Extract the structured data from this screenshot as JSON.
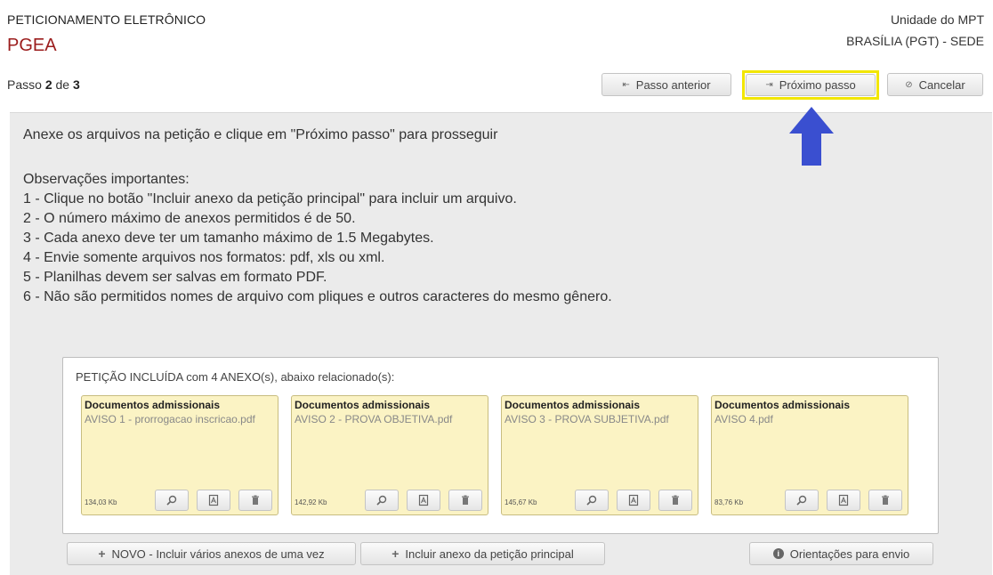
{
  "header": {
    "app_label": "PETICIONAMENTO ELETRÔNICO",
    "app_title": "PGEA",
    "unit_label": "Unidade do MPT",
    "unit_value": "BRASÍLIA (PGT) - SEDE"
  },
  "step": {
    "prefix": "Passo",
    "current": "2",
    "sep": "de",
    "total": "3"
  },
  "toolbar": {
    "prev_label": "Passo anterior",
    "next_label": "Próximo passo",
    "cancel_label": "Cancelar"
  },
  "instructions": "Anexe os arquivos na petição e clique em \"Próximo passo\" para prosseguir",
  "notes": {
    "title": "Observações importantes:",
    "items": [
      "1 - Clique no botão \"Incluir anexo da petição principal\" para incluir um arquivo.",
      "2 - O número máximo de anexos permitidos é de 50.",
      "3 - Cada anexo deve ter um tamanho máximo de 1.5 Megabytes.",
      "4 - Envie somente arquivos nos formatos: pdf, xls ou xml.",
      "5 - Planilhas devem ser salvas em formato PDF.",
      "6 - Não são permitidos nomes de arquivo com pliques e outros caracteres do mesmo gênero."
    ]
  },
  "attachments": {
    "header": "PETIÇÃO INCLUÍDA com 4 ANEXO(s), abaixo relacionado(s):",
    "items": [
      {
        "type": "Documentos admissionais",
        "file": "AVISO 1 - prorrogacao inscricao.pdf",
        "size": "134,03 Kb"
      },
      {
        "type": "Documentos admissionais",
        "file": "AVISO 2 - PROVA OBJETIVA.pdf",
        "size": "142,92 Kb"
      },
      {
        "type": "Documentos admissionais",
        "file": "AVISO 3 - PROVA SUBJETIVA.pdf",
        "size": "145,67 Kb"
      },
      {
        "type": "Documentos admissionais",
        "file": "AVISO 4.pdf",
        "size": "83,76 Kb"
      }
    ]
  },
  "footer": {
    "novo_label": "NOVO - Incluir vários anexos de uma vez",
    "incluir_label": "Incluir anexo da petição principal",
    "orient_label": "Orientações para envio"
  },
  "colors": {
    "title_red": "#9b1c1c",
    "highlight_yellow": "#f2e600",
    "arrow_blue": "#3a4fd0",
    "card_bg": "#fbf3c4"
  },
  "icons": {
    "prev": "skip-back-icon",
    "next": "skip-forward-icon",
    "cancel": "cancel-circle-icon",
    "arrow": "up-arrow-icon",
    "view": "magnifier-icon",
    "pdf": "pdf-file-icon",
    "delete": "trash-icon",
    "plus": "plus-icon",
    "info": "info-icon"
  }
}
